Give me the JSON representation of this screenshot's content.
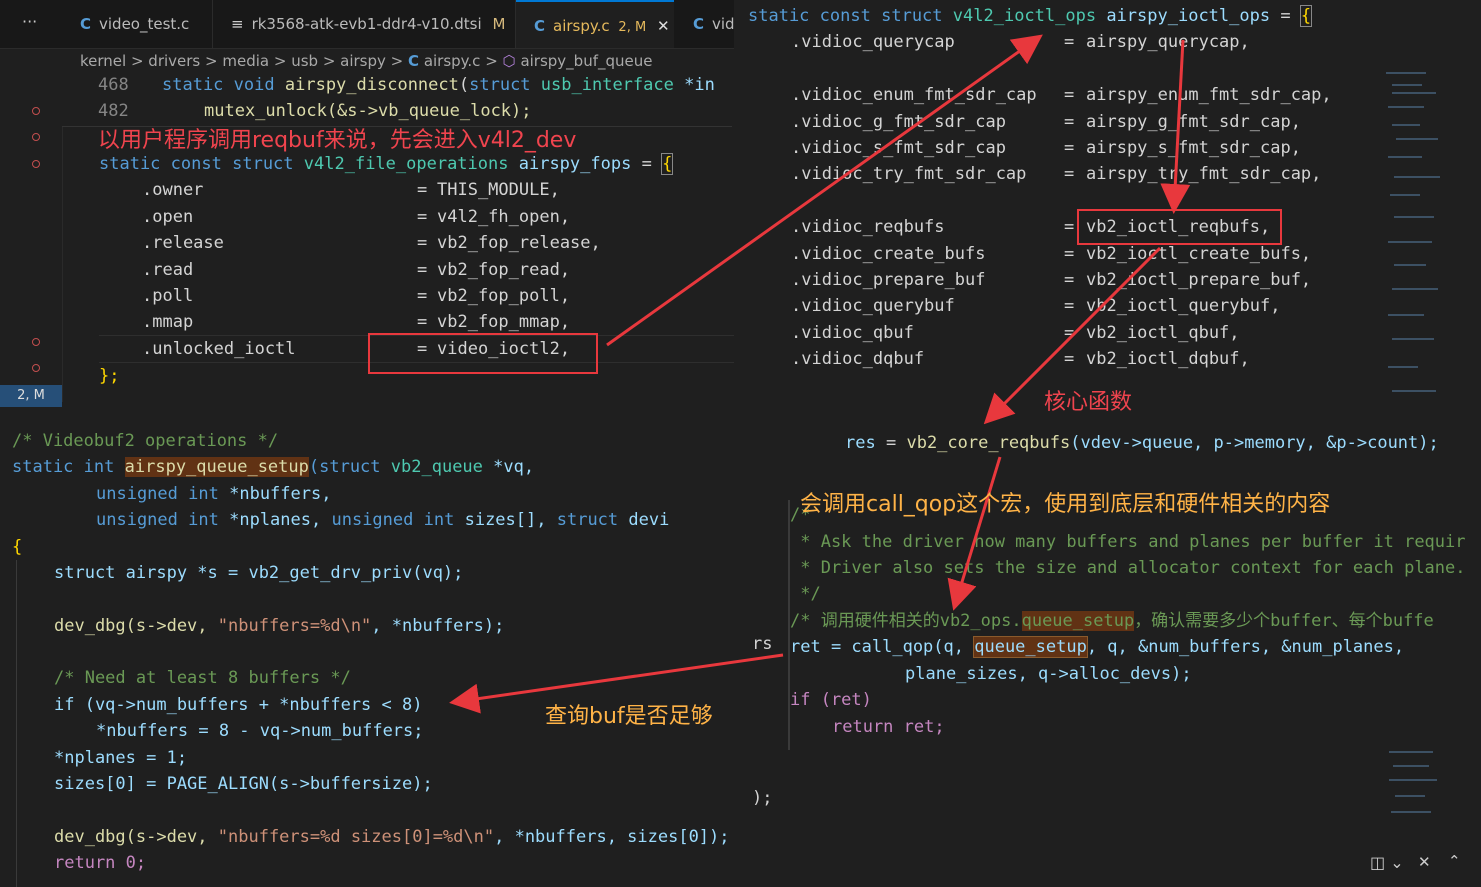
{
  "tabs": [
    {
      "icon": "C",
      "label": "video_test.c",
      "suffix": ""
    },
    {
      "icon": "≡",
      "label": "rk3568-atk-evb1-ddr4-v10.dtsi",
      "suffix": "M"
    },
    {
      "icon": "C",
      "label": "airspy.c",
      "suffix": "2, M"
    },
    {
      "icon": "C",
      "label": "vid",
      "suffix": ""
    }
  ],
  "more_tabs_icon": "···",
  "breadcrumb": [
    "kernel",
    "drivers",
    "media",
    "usb",
    "airspy",
    "airspy.c",
    "airspy_buf_queue"
  ],
  "status": "2, M",
  "line_numbers": [
    "468",
    "482"
  ],
  "annotations": {
    "fops_note": "以用户程序调用reqbuf来说，先会进入v4l2_dev",
    "core": "核心函数",
    "call_qop": "会调用call_qop这个宏，使用到底层和硬件相关的内容",
    "check_buf": "查询buf是否足够"
  },
  "panel_top_left": {
    "row468": [
      "static",
      "void",
      "airspy_disconnect",
      "struct",
      "usb_interface",
      "*in"
    ],
    "row482": [
      "mutex_unlock(&s->vb_queue_lock);"
    ],
    "fops_header": [
      "static",
      "const",
      "struct",
      "v4l2_file_operations",
      "airspy_fops",
      "=",
      "{"
    ],
    "fops": [
      {
        "k": ".owner",
        "v": "THIS_MODULE,"
      },
      {
        "k": ".open",
        "v": "v4l2_fh_open,"
      },
      {
        "k": ".release",
        "v": "vb2_fop_release,"
      },
      {
        "k": ".read",
        "v": "vb2_fop_read,"
      },
      {
        "k": ".poll",
        "v": "vb2_fop_poll,"
      },
      {
        "k": ".mmap",
        "v": "vb2_fop_mmap,"
      },
      {
        "k": ".unlocked_ioctl",
        "v": "video_ioctl2,"
      }
    ],
    "closing": "};"
  },
  "panel_top_right": {
    "header": [
      "static",
      "const",
      "struct",
      "v4l2_ioctl_ops",
      "airspy_ioctl_ops",
      "=",
      "{"
    ],
    "ops": [
      {
        "k": ".vidioc_querycap",
        "v": "airspy_querycap,"
      },
      {
        "k": "",
        "v": ""
      },
      {
        "k": ".vidioc_enum_fmt_sdr_cap",
        "v": "airspy_enum_fmt_sdr_cap,"
      },
      {
        "k": ".vidioc_g_fmt_sdr_cap",
        "v": "airspy_g_fmt_sdr_cap,"
      },
      {
        "k": ".vidioc_s_fmt_sdr_cap",
        "v": "airspy_s_fmt_sdr_cap,"
      },
      {
        "k": ".vidioc_try_fmt_sdr_cap",
        "v": "airspy_try_fmt_sdr_cap,"
      },
      {
        "k": "",
        "v": ""
      },
      {
        "k": ".vidioc_reqbufs",
        "v": "vb2_ioctl_reqbufs,"
      },
      {
        "k": ".vidioc_create_bufs",
        "v": "vb2_ioctl_create_bufs,"
      },
      {
        "k": ".vidioc_prepare_buf",
        "v": "vb2_ioctl_prepare_buf,"
      },
      {
        "k": ".vidioc_querybuf",
        "v": "vb2_ioctl_querybuf,"
      },
      {
        "k": ".vidioc_qbuf",
        "v": "vb2_ioctl_qbuf,"
      },
      {
        "k": ".vidioc_dqbuf",
        "v": "vb2_ioctl_dqbuf,"
      }
    ]
  },
  "panel_res": {
    "line": [
      "res",
      "=",
      "vb2_core_reqbufs",
      "(vdev->queue,",
      "p->memory,",
      "&p->count);"
    ]
  },
  "panel_core": {
    "comment": [
      "/*",
      " * Ask the driver how many buffers and planes per buffer it requir",
      " * Driver also sets the size and allocator context for each plane.",
      " */"
    ],
    "comment_cn_prefix": "/* 调用硬件相关的vb2_ops.",
    "comment_cn_hl": "queue_setup",
    "comment_cn_suffix": "，确认需要多少个buffer、每个buffe",
    "ret_prefix": "ret = call_qop(q, ",
    "ret_hl": "queue_setup",
    "ret_suffix": ", q, &num_buffers, &num_planes,",
    "ret_cont": "plane_sizes, q->alloc_devs);",
    "if_line": "if (ret)",
    "return_line": "return ret;",
    "rs": "rs",
    "closing": ");"
  },
  "panel_bottom_left": {
    "comment": "/* Videobuf2 operations */",
    "sig": [
      "static",
      "int",
      "airspy_queue_setup",
      "(struct",
      "vb2_queue",
      "*vq,"
    ],
    "args1": [
      "unsigned",
      "int",
      "*nbuffers,"
    ],
    "args2": [
      "unsigned",
      "int",
      "*nplanes,",
      "unsigned",
      "int",
      "sizes[],",
      "struct",
      "devi"
    ],
    "brace": "{",
    "l1": "struct airspy *s = vb2_get_drv_priv(vq);",
    "l2_pre": "dev_dbg(s->dev, ",
    "l2_str": "\"nbuffers=%d\\n\"",
    "l2_post": ", *nbuffers);",
    "l3": "/* Need at least 8 buffers */",
    "l4": "if (vq->num_buffers + *nbuffers < 8)",
    "l5": "*nbuffers = 8 - vq->num_buffers;",
    "l6": "*nplanes = 1;",
    "l7": "sizes[0] = PAGE_ALIGN(s->buffersize);",
    "l8_pre": "dev_dbg(s->dev, ",
    "l8_str": "\"nbuffers=%d sizes[0]=%d\\n\"",
    "l8_post": ", *nbuffers, sizes[0]);",
    "l9": "return 0;"
  },
  "colors": {
    "annotation": "#f0444e",
    "box": "#e8383d",
    "bg": "#1f1f1f"
  }
}
